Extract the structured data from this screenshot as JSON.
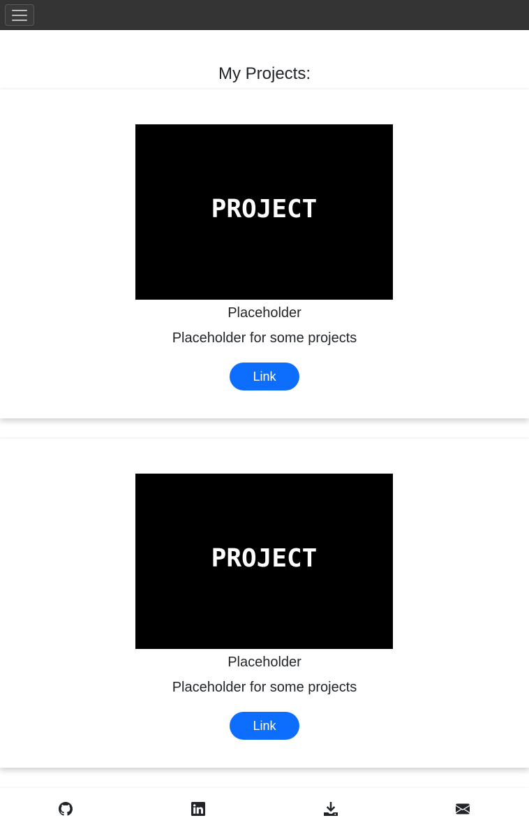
{
  "navbar": {
    "toggler_icon": "hamburger-menu-icon"
  },
  "page": {
    "heading": "My Projects:"
  },
  "projects": [
    {
      "image_text": "PROJECT",
      "title": "Placeholder",
      "description": "Placeholder for some projects",
      "button_label": "Link"
    },
    {
      "image_text": "PROJECT",
      "title": "Placeholder",
      "description": "Placeholder for some projects",
      "button_label": "Link"
    }
  ],
  "footer": {
    "icons": [
      "github-icon",
      "linkedin-icon",
      "download-icon",
      "envelope-icon"
    ]
  },
  "colors": {
    "navbar_bg": "#343434",
    "button_bg": "#0d6efd",
    "text": "#212529"
  }
}
